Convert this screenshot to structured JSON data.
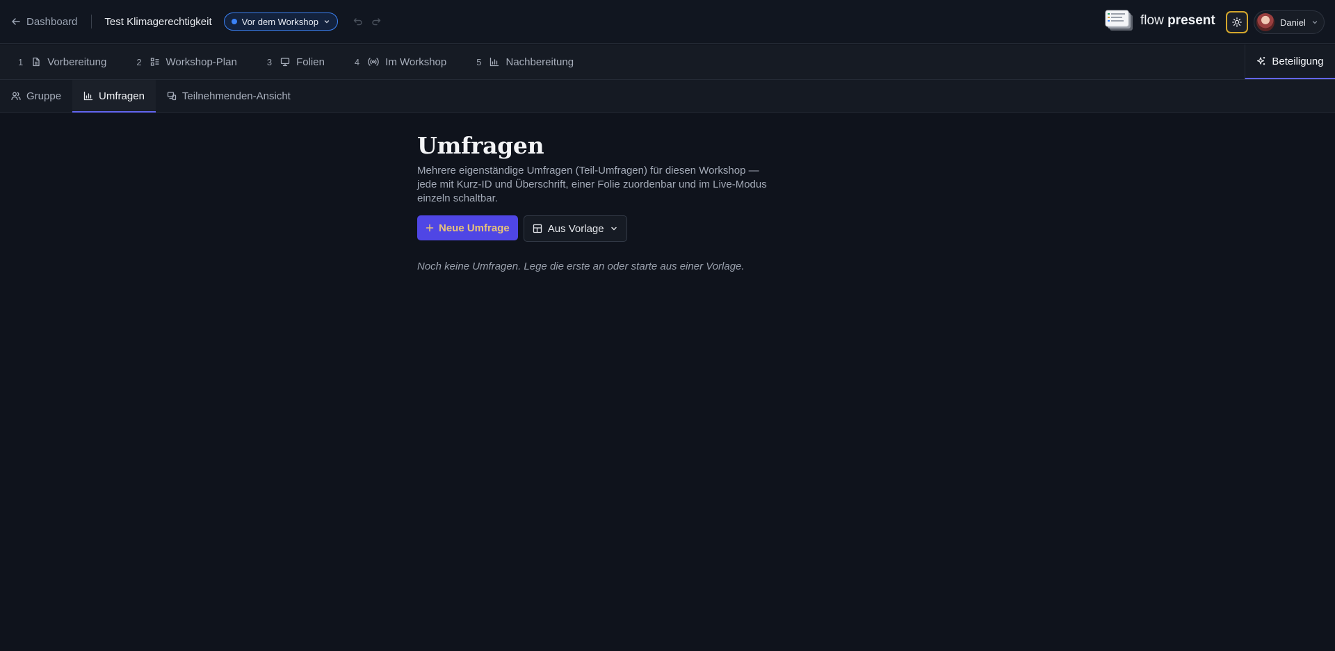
{
  "header": {
    "back_label": "Dashboard",
    "workshop_title": "Test Klimagerechtigkeit",
    "status_label": "Vor dem Workshop",
    "status_color": "#3b82f6",
    "brand_light": "flow",
    "brand_bold": "present",
    "user_name": "Daniel"
  },
  "steps": [
    {
      "number": "1",
      "label": "Vorbereitung",
      "icon": "document-icon"
    },
    {
      "number": "2",
      "label": "Workshop-Plan",
      "icon": "checklist-icon"
    },
    {
      "number": "3",
      "label": "Folien",
      "icon": "presentation-icon"
    },
    {
      "number": "4",
      "label": "Im Workshop",
      "icon": "broadcast-icon"
    },
    {
      "number": "5",
      "label": "Nachbereitung",
      "icon": "bar-chart-icon"
    }
  ],
  "participation_tab": {
    "label": "Beteiligung",
    "icon": "sparkles-icon"
  },
  "subtabs": [
    {
      "label": "Gruppe",
      "icon": "users-icon",
      "active": false
    },
    {
      "label": "Umfragen",
      "icon": "bar-chart-icon",
      "active": true
    },
    {
      "label": "Teilnehmenden-Ansicht",
      "icon": "devices-icon",
      "active": false
    }
  ],
  "main": {
    "title": "Umfragen",
    "description": "Mehrere eigenständige Umfragen (Teil-Umfragen) für diesen Workshop — jede mit Kurz-ID und Überschrift, einer Folie zuordenbar und im Live-Modus einzeln schaltbar.",
    "new_poll_label": "Neue Umfrage",
    "template_label": "Aus Vorlage",
    "empty_message": "Noch keine Umfragen. Lege die erste an oder starte aus einer Vorlage."
  },
  "colors": {
    "accent": "#4f46e5",
    "tab_indicator": "#6366f1",
    "theme_ring": "#d4a72c"
  }
}
